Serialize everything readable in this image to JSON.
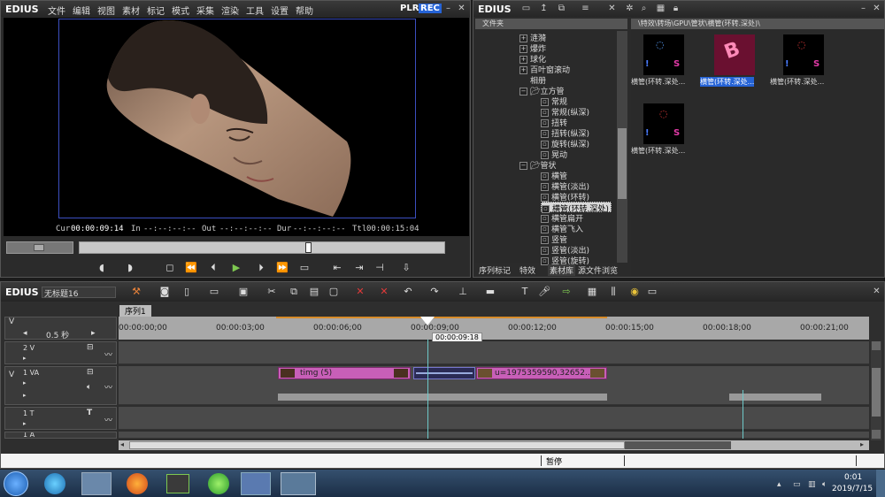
{
  "app": {
    "name": "EDIUS",
    "plr_label": "PLR",
    "rec_label": "REC"
  },
  "menu": [
    "文件",
    "编辑",
    "视图",
    "素材",
    "标记",
    "模式",
    "采集",
    "渲染",
    "工具",
    "设置",
    "帮助"
  ],
  "timecodes": {
    "cur_label": "Cur",
    "cur": "00:00:09:14",
    "in_label": "In",
    "in": "--:--:--:--",
    "out_label": "Out",
    "out": "--:--:--:--",
    "dur_label": "Dur",
    "dur": "--:--:--:--",
    "ttl_label": "Ttl",
    "ttl": "00:00:15:04"
  },
  "bin": {
    "logo": "EDIUS",
    "folder_header": "文件夹",
    "path": "\\特效\\转场\\GPU\\管状\\横管(环转.深处)\\",
    "tree": [
      "涟漪",
      "爆炸",
      "球化",
      "百叶窗滚动",
      "相册",
      "立方管",
      "常规",
      "常规(纵深)",
      "扭转",
      "扭转(纵深)",
      "旋转(纵深)",
      "晃动",
      "管状",
      "横管",
      "横管(淡出)",
      "横管(环转)",
      "横管(环转.深处)",
      "横管扁开",
      "横管飞入",
      "竖管",
      "竖管(淡出)",
      "竖管(旋转)"
    ],
    "thumbs": [
      "横管(环转.深处...",
      "横管(环转.深处...",
      "横管(环转.深处...",
      "横管(环转.深处..."
    ],
    "tabs": [
      "序列标记",
      "特效",
      "素材库",
      "源文件浏览"
    ]
  },
  "timeline": {
    "logo": "EDIUS",
    "project": "无标题16",
    "sequence_tab": "序列1",
    "zoom": "0.5 秒",
    "playhead_time": "00:00:09:18",
    "ruler": [
      "00:00:00;00",
      "00:00:03;00",
      "00:00:06;00",
      "00:00:09;00",
      "00:00:12;00",
      "00:00:15;00",
      "00:00:18;00",
      "00:00:21;00"
    ],
    "tracks": [
      {
        "name": "2 V"
      },
      {
        "name": "1 VA"
      },
      {
        "name": "1 T"
      },
      {
        "name": "1 A"
      }
    ],
    "clip1": "timg (5)",
    "clip2": "u=1975359590,32652..."
  },
  "status": {
    "mode": "暂停"
  },
  "taskbar": {
    "time": "0:01",
    "date": "2019/7/15"
  },
  "colors": {
    "accent": "#c85fb8",
    "panel": "#2b2b2b",
    "rec": "#2563d6"
  }
}
